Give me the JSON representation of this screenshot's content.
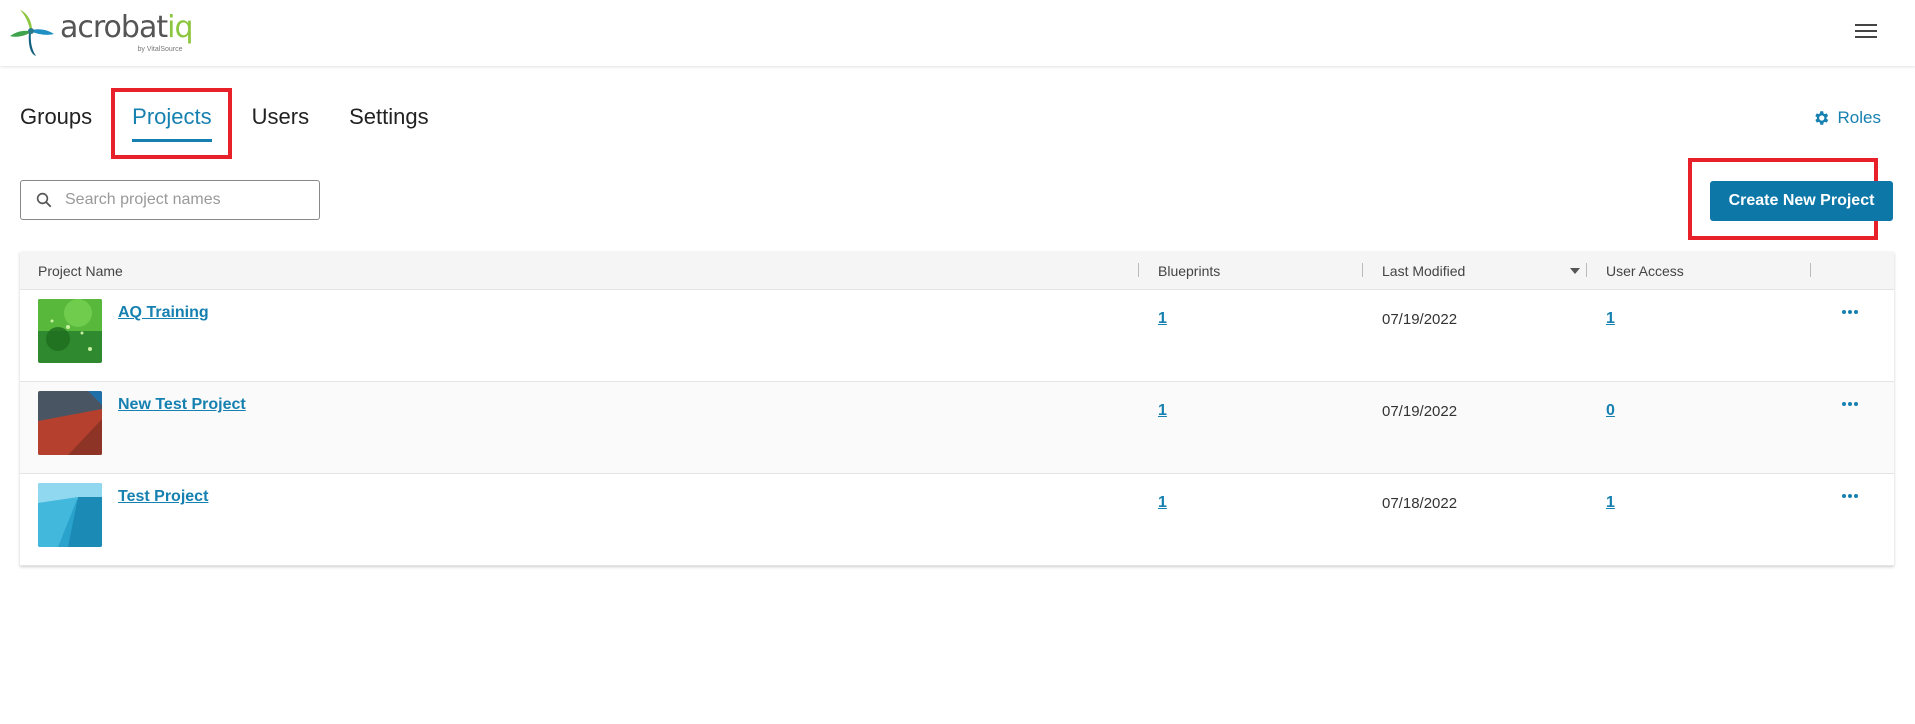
{
  "app": {
    "logo_word": "acrobat",
    "logo_word_accent": "iq",
    "logo_byline": "by VitalSource"
  },
  "tabs": [
    {
      "label": "Groups",
      "active": false
    },
    {
      "label": "Projects",
      "active": true
    },
    {
      "label": "Users",
      "active": false
    },
    {
      "label": "Settings",
      "active": false
    }
  ],
  "roles_label": "Roles",
  "search": {
    "placeholder": "Search project names",
    "value": ""
  },
  "create_button_label": "Create New Project",
  "table": {
    "headers": {
      "project_name": "Project Name",
      "blueprints": "Blueprints",
      "last_modified": "Last Modified",
      "user_access": "User Access"
    },
    "sort_column": "Last Modified",
    "rows": [
      {
        "name": "AQ Training",
        "blueprints": "1",
        "last_modified": "07/19/2022",
        "user_access": "1",
        "thumbnail": "green-abstract"
      },
      {
        "name": "New Test Project",
        "blueprints": "1",
        "last_modified": "07/19/2022",
        "user_access": "0",
        "thumbnail": "red-gray-geometric"
      },
      {
        "name": "Test Project",
        "blueprints": "1",
        "last_modified": "07/18/2022",
        "user_access": "1",
        "thumbnail": "blue-geometric"
      }
    ]
  },
  "colors": {
    "accent": "#1680b0",
    "button": "#0d77a8",
    "highlight": "#e8202a",
    "logo_green": "#8cc63f"
  }
}
